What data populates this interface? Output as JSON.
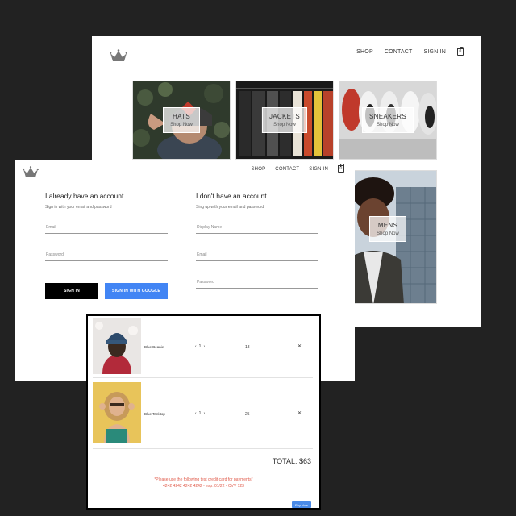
{
  "shop": {
    "nav": {
      "shop": "SHOP",
      "contact": "CONTACT",
      "sign_in": "SIGN IN",
      "cart_count": "0"
    },
    "tiles": [
      {
        "title": "HATS",
        "subtitle": "Shop Now"
      },
      {
        "title": "JACKETS",
        "subtitle": "Shop Now"
      },
      {
        "title": "SNEAKERS",
        "subtitle": "Shop Now"
      },
      {
        "title": "MENS",
        "subtitle": "Shop Now"
      }
    ]
  },
  "auth": {
    "nav": {
      "shop": "SHOP",
      "contact": "CONTACT",
      "sign_in": "SIGN IN",
      "cart_count": "0"
    },
    "signin": {
      "title": "I already have an account",
      "subtitle": "Sign in with your email and password",
      "email_placeholder": "Email",
      "password_placeholder": "Password",
      "signin_button": "SIGN IN",
      "google_button": "SIGN IN WITH GOOGLE"
    },
    "signup": {
      "title": "I don't have an account",
      "subtitle": "Sing up with your email and password",
      "display_name_placeholder": "Display Name",
      "email_placeholder": "Email",
      "password_placeholder": "Password"
    }
  },
  "checkout": {
    "items": [
      {
        "name": "Blue Beanie",
        "quantity": "1",
        "price": "18",
        "remove": "✕"
      },
      {
        "name": "Blue Tanktop",
        "quantity": "1",
        "price": "25",
        "remove": "✕"
      }
    ],
    "qty_prev": "‹",
    "qty_next": "›",
    "total": "TOTAL: $63",
    "warning_line1": "*Please use the following test credit card for payments*",
    "warning_line2": "4242 4242 4242 4242 - exp: 01/22 - CVV 123",
    "pay_button": "Pay Now"
  },
  "colors": {
    "background": "#222222",
    "google_button": "#4285f4",
    "signin_button": "#000000",
    "warning_text": "#e05a4a",
    "pay_button": "#4a8be8"
  }
}
